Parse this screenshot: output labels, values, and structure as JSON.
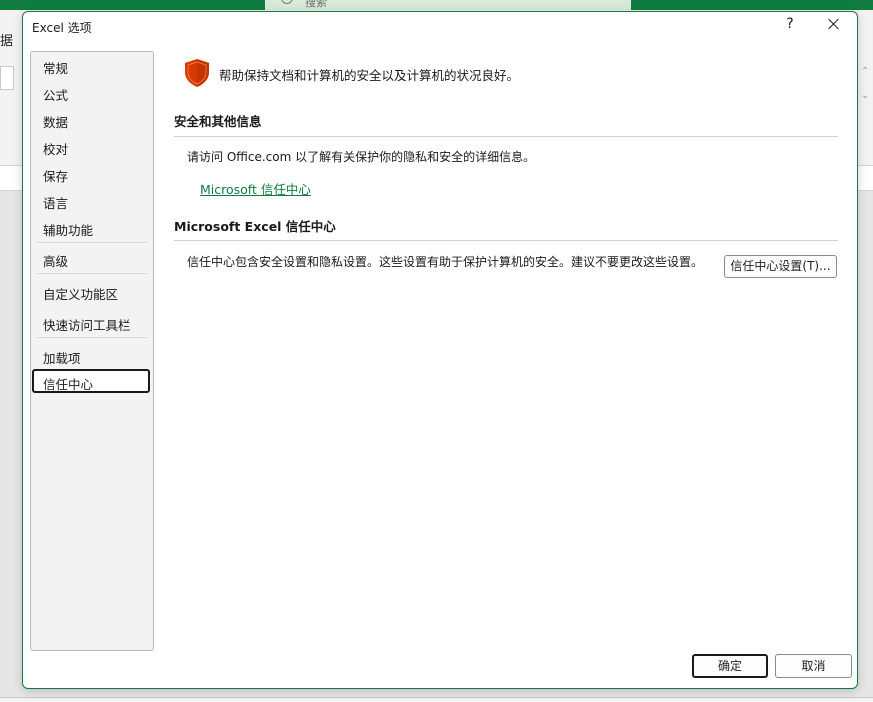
{
  "background": {
    "search_placeholder": "搜索",
    "ribbon_tab_fragment": "据"
  },
  "dialog": {
    "title": "Excel 选项",
    "help_label": "?",
    "close_icon": "close-icon"
  },
  "nav": {
    "items": [
      {
        "label": "常规"
      },
      {
        "label": "公式"
      },
      {
        "label": "数据"
      },
      {
        "label": "校对"
      },
      {
        "label": "保存"
      },
      {
        "label": "语言"
      },
      {
        "label": "辅助功能"
      },
      {
        "label": "高级"
      },
      {
        "label": "自定义功能区"
      },
      {
        "label": "快速访问工具栏"
      },
      {
        "label": "加载项"
      },
      {
        "label": "信任中心"
      }
    ],
    "selected": "信任中心"
  },
  "content": {
    "shield_icon": "shield-icon",
    "intro": "帮助保持文档和计算机的安全以及计算机的状况良好。",
    "section1": {
      "heading": "安全和其他信息",
      "text": "请访问 Office.com  以了解有关保护你的隐私和安全的详细信息。",
      "link": "Microsoft 信任中心"
    },
    "section2": {
      "heading": "Microsoft Excel 信任中心",
      "text": "信任中心包含安全设置和隐私设置。这些设置有助于保护计算机的安全。建议不要更改这些设置。",
      "button": "信任中心设置(T)..."
    }
  },
  "footer": {
    "ok": "确定",
    "cancel": "取消"
  },
  "colors": {
    "accent": "#107c41",
    "shield": "#d83b01"
  }
}
